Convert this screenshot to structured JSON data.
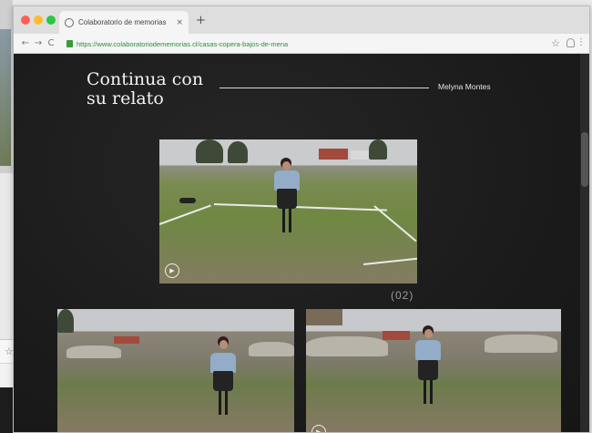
{
  "browser": {
    "tab_title": "Colaboratorio de memorias",
    "tab_close": "×",
    "new_tab": "+",
    "url": "https://www.colaboratoriodememorias.cl/casas-copera-bajos-de-mena",
    "back": "←",
    "forward": "→",
    "reload": "C",
    "bookmark_star": "☆"
  },
  "page": {
    "heading": "Continua con su relato",
    "author": "Melyna Montes",
    "counter": "(02)",
    "play_symbol": "▶"
  },
  "colors": {
    "page_background": "#1b1b1b",
    "url_green": "#2e8b3a"
  }
}
